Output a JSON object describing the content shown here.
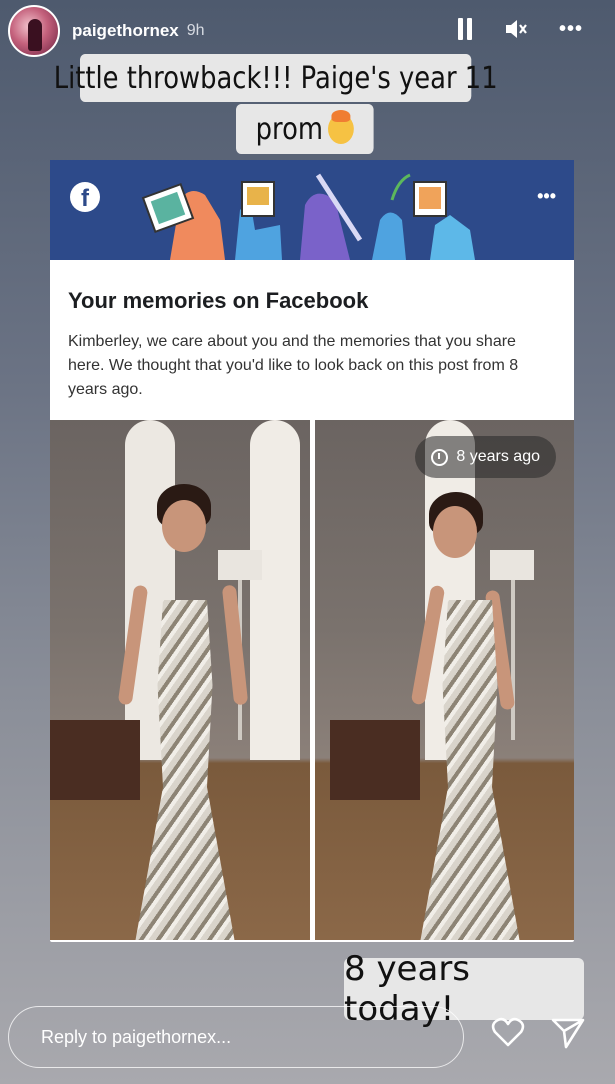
{
  "header": {
    "username": "paigethornex",
    "time": "9h",
    "icons": {
      "pause": "pause-icon",
      "mute": "mute-icon",
      "more": "more-icon"
    },
    "more_label": "•••"
  },
  "captions": {
    "line1": "Little throwback!!! Paige's year 11",
    "line2": "prom",
    "emoji": "exploding-head-emoji",
    "bottom": "8 years today!"
  },
  "facebook_card": {
    "logo": "f",
    "more": "•••",
    "title": "Your memories on Facebook",
    "body": "Kimberley, we care about you and the memories that you share here. We thought that you'd like to look back on this post from 8 years ago.",
    "badge": "8 years ago"
  },
  "footer": {
    "reply_placeholder": "Reply to paigethornex...",
    "icons": {
      "like": "heart-icon",
      "share": "send-icon"
    }
  },
  "colors": {
    "facebook_blue": "#2d4a8a",
    "caption_bg": "#e7e7e7"
  }
}
